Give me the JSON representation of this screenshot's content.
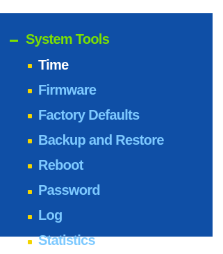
{
  "menu": {
    "section_title": "System Tools",
    "items": [
      {
        "label": "Time",
        "active": true
      },
      {
        "label": "Firmware",
        "active": false
      },
      {
        "label": "Factory Defaults",
        "active": false
      },
      {
        "label": "Backup and Restore",
        "active": false
      },
      {
        "label": "Reboot",
        "active": false
      },
      {
        "label": "Password",
        "active": false
      },
      {
        "label": "Log",
        "active": false
      },
      {
        "label": "Statistics",
        "active": false
      }
    ]
  },
  "colors": {
    "panel_background": "#0f4fa6",
    "section_title": "#7de000",
    "item_text": "#7dc9ff",
    "active_item_text": "#ffffff",
    "bullet": "#f3d400"
  }
}
